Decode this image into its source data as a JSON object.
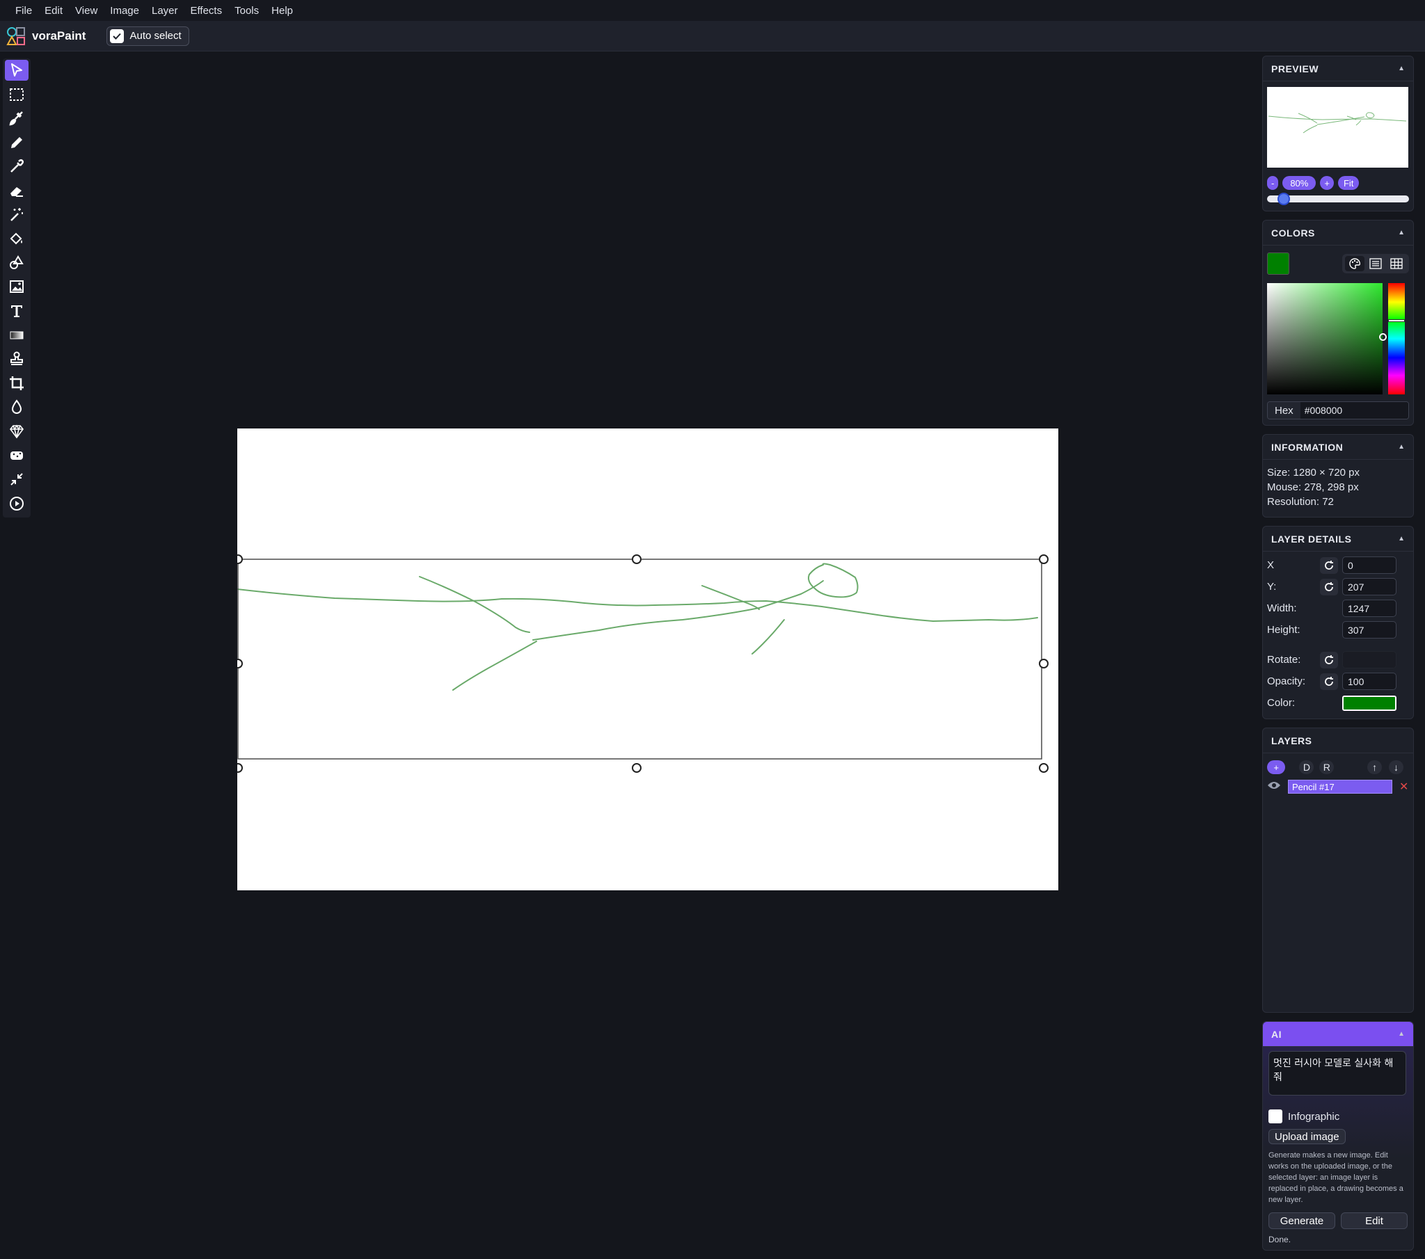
{
  "menu": [
    "File",
    "Edit",
    "View",
    "Image",
    "Layer",
    "Effects",
    "Tools",
    "Help"
  ],
  "app": {
    "title": "voraPaint"
  },
  "toolbar": {
    "auto_select_label": "Auto select",
    "auto_select_checked": true
  },
  "tools": [
    {
      "name": "select-tool-icon",
      "active": true
    },
    {
      "name": "marquee-tool-icon"
    },
    {
      "name": "brush-tool-icon"
    },
    {
      "name": "pencil-tool-icon"
    },
    {
      "name": "eyedropper-tool-icon"
    },
    {
      "name": "eraser-tool-icon"
    },
    {
      "name": "magic-wand-tool-icon"
    },
    {
      "name": "fill-bucket-tool-icon"
    },
    {
      "name": "shapes-tool-icon"
    },
    {
      "name": "image-tool-icon"
    },
    {
      "name": "text-tool-icon"
    },
    {
      "name": "gradient-tool-icon"
    },
    {
      "name": "stamp-tool-icon"
    },
    {
      "name": "crop-tool-icon"
    },
    {
      "name": "blur-tool-icon"
    },
    {
      "name": "sharpen-tool-icon"
    },
    {
      "name": "sponge-tool-icon"
    },
    {
      "name": "resize-tool-icon"
    },
    {
      "name": "play-tool-icon"
    }
  ],
  "preview": {
    "title": "PREVIEW",
    "zoom_out": "-",
    "zoom": "80%",
    "zoom_in": "+",
    "fit": "Fit",
    "slider_value": 0.08
  },
  "colors": {
    "title": "COLORS",
    "current": "#008000",
    "hex_label": "Hex",
    "hex_value": "#008000"
  },
  "information": {
    "title": "INFORMATION",
    "size": "Size: 1280 × 720 px",
    "mouse": "Mouse: 278, 298 px",
    "resolution": "Resolution: 72"
  },
  "layer_details": {
    "title": "LAYER DETAILS",
    "x_label": "X",
    "x_value": "0",
    "y_label": "Y:",
    "y_value": "207",
    "width_label": "Width:",
    "width_value": "1247",
    "height_label": "Height:",
    "height_value": "307",
    "rotate_label": "Rotate:",
    "rotate_value": "",
    "opacity_label": "Opacity:",
    "opacity_value": "100",
    "color_label": "Color:",
    "color_value": "#008000"
  },
  "layers": {
    "title": "LAYERS",
    "add": "+",
    "duplicate": "D",
    "rename": "R",
    "up": "↑",
    "down": "↓",
    "items": [
      {
        "name": "Pencil #17",
        "visible": true,
        "selected": true
      }
    ]
  },
  "ai": {
    "title": "AI",
    "prompt": "멋진 러시아 모델로 실사화 해줘",
    "infographic_label": "Infographic",
    "infographic_checked": false,
    "upload_label": "Upload image",
    "help_text": "Generate makes a new image. Edit works on the uploaded image, or the selected layer: an image layer is replaced in place, a drawing becomes a new layer.",
    "generate_label": "Generate",
    "edit_label": "Edit",
    "status": "Done."
  }
}
